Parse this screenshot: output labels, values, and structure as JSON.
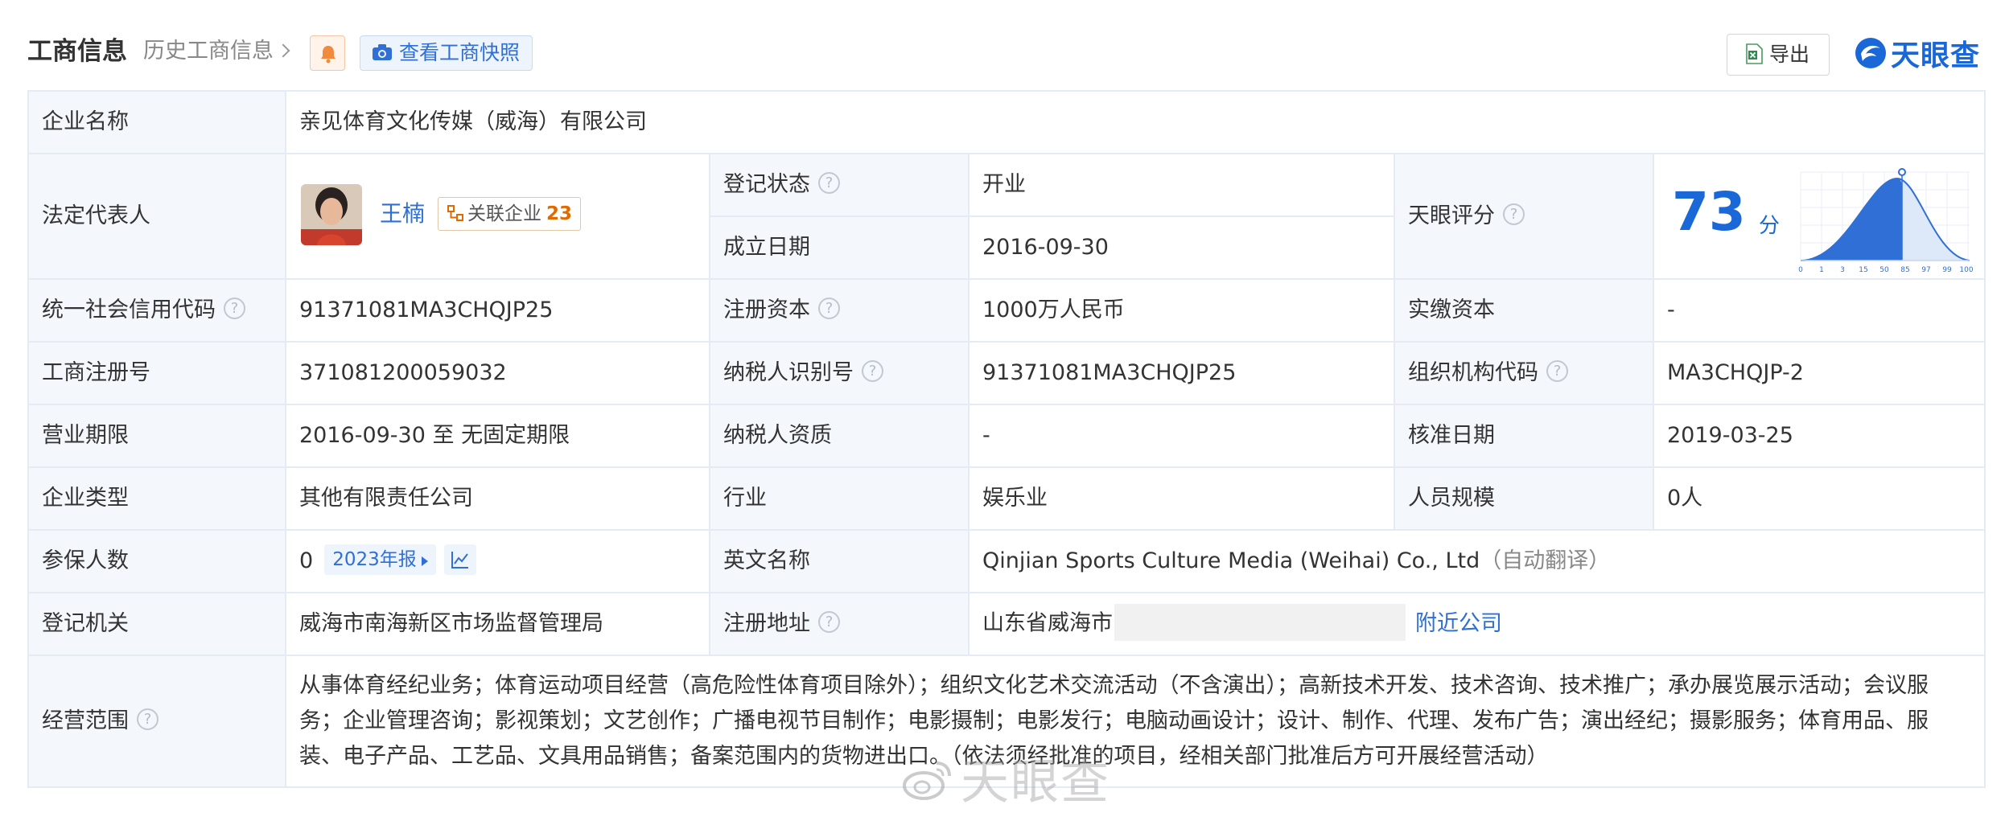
{
  "header": {
    "title": "工商信息",
    "history_label": "历史工商信息",
    "snapshot_label": "查看工商快照",
    "export_label": "导出",
    "brand": "天眼查"
  },
  "company": {
    "name_label": "企业名称",
    "name": "亲见体育文化传媒（威海）有限公司"
  },
  "legal_rep": {
    "label": "法定代表人",
    "name": "王楠",
    "assoc_label": "关联企业",
    "assoc_count": "23"
  },
  "status": {
    "label": "登记状态",
    "value": "开业"
  },
  "founded": {
    "label": "成立日期",
    "value": "2016-09-30"
  },
  "score": {
    "label": "天眼评分",
    "value": "73",
    "unit": "分",
    "ticks": [
      "0",
      "1",
      "3",
      "15",
      "50",
      "85",
      "97",
      "99",
      "100"
    ]
  },
  "credit_code": {
    "label": "统一社会信用代码",
    "value": "91371081MA3CHQJP25"
  },
  "reg_capital": {
    "label": "注册资本",
    "value": "1000万人民币"
  },
  "paid_capital": {
    "label": "实缴资本",
    "value": "-"
  },
  "reg_no": {
    "label": "工商注册号",
    "value": "371081200059032"
  },
  "taxpayer_id": {
    "label": "纳税人识别号",
    "value": "91371081MA3CHQJP25"
  },
  "org_code": {
    "label": "组织机构代码",
    "value": "MA3CHQJP-2"
  },
  "term": {
    "label": "营业期限",
    "value": "2016-09-30 至 无固定期限"
  },
  "tax_qual": {
    "label": "纳税人资质",
    "value": "-"
  },
  "approve_date": {
    "label": "核准日期",
    "value": "2019-03-25"
  },
  "company_type": {
    "label": "企业类型",
    "value": "其他有限责任公司"
  },
  "industry": {
    "label": "行业",
    "value": "娱乐业"
  },
  "staff_size": {
    "label": "人员规模",
    "value": "0人"
  },
  "insured": {
    "label": "参保人数",
    "value": "0",
    "year_label": "2023年报"
  },
  "english_name": {
    "label": "英文名称",
    "value": "Qinjian Sports Culture Media (Weihai) Co., Ltd",
    "note": "（自动翻译）"
  },
  "reg_authority": {
    "label": "登记机关",
    "value": "威海市南海新区市场监督管理局"
  },
  "address": {
    "label": "注册地址",
    "value": "山东省威海市",
    "nearby_label": "附近公司"
  },
  "scope": {
    "label": "经营范围",
    "value": "从事体育经纪业务；体育运动项目经营（高危险性体育项目除外）；组织文化艺术交流活动（不含演出）；高新技术开发、技术咨询、技术推广；承办展览展示活动；会议服务；企业管理咨询；影视策划；文艺创作；广播电视节目制作；电影摄制；电影发行；电脑动画设计；设计、制作、代理、发布广告；演出经纪；摄影服务；体育用品、服装、电子产品、工艺品、文具用品销售；备案范围内的货物进出口。（依法须经批准的项目，经相关部门批准后方可开展经营活动）"
  },
  "watermark": "天眼查"
}
